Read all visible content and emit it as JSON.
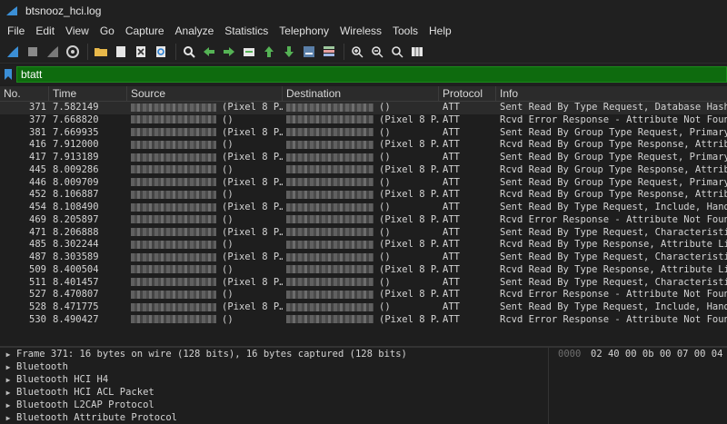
{
  "window": {
    "title": "btsnooz_hci.log"
  },
  "menu": [
    "File",
    "Edit",
    "View",
    "Go",
    "Capture",
    "Analyze",
    "Statistics",
    "Telephony",
    "Wireless",
    "Tools",
    "Help"
  ],
  "filter": {
    "value": "btatt"
  },
  "columns": {
    "no": "No.",
    "time": "Time",
    "source": "Source",
    "destination": "Destination",
    "protocol": "Protocol",
    "info": "Info"
  },
  "packets": [
    {
      "no": "371",
      "time": "7.582149",
      "src": "(Pixel 8 P…",
      "dst": "()",
      "proto": "ATT",
      "info": "Sent Read By Type Request, Database Hash,",
      "selected": true
    },
    {
      "no": "377",
      "time": "7.668820",
      "src": "()",
      "dst": "(Pixel 8 P…",
      "proto": "ATT",
      "info": "Rcvd Error Response - Attribute Not Found"
    },
    {
      "no": "381",
      "time": "7.669935",
      "src": "(Pixel 8 P…",
      "dst": "()",
      "proto": "ATT",
      "info": "Sent Read By Group Type Request, Primary"
    },
    {
      "no": "416",
      "time": "7.912000",
      "src": "()",
      "dst": "(Pixel 8 P…",
      "proto": "ATT",
      "info": "Rcvd Read By Group Type Response, Attribu"
    },
    {
      "no": "417",
      "time": "7.913189",
      "src": "(Pixel 8 P…",
      "dst": "()",
      "proto": "ATT",
      "info": "Sent Read By Group Type Request, Primary"
    },
    {
      "no": "445",
      "time": "8.009286",
      "src": "()",
      "dst": "(Pixel 8 P…",
      "proto": "ATT",
      "info": "Rcvd Read By Group Type Response, Attribu"
    },
    {
      "no": "446",
      "time": "8.009709",
      "src": "(Pixel 8 P…",
      "dst": "()",
      "proto": "ATT",
      "info": "Sent Read By Group Type Request, Primary"
    },
    {
      "no": "452",
      "time": "8.106887",
      "src": "()",
      "dst": "(Pixel 8 P…",
      "proto": "ATT",
      "info": "Rcvd Read By Group Type Response, Attribu"
    },
    {
      "no": "454",
      "time": "8.108490",
      "src": "(Pixel 8 P…",
      "dst": "()",
      "proto": "ATT",
      "info": "Sent Read By Type Request, Include, Handl"
    },
    {
      "no": "469",
      "time": "8.205897",
      "src": "()",
      "dst": "(Pixel 8 P…",
      "proto": "ATT",
      "info": "Rcvd Error Response - Attribute Not Found"
    },
    {
      "no": "471",
      "time": "8.206888",
      "src": "(Pixel 8 P…",
      "dst": "()",
      "proto": "ATT",
      "info": "Sent Read By Type Request, Characteristic"
    },
    {
      "no": "485",
      "time": "8.302244",
      "src": "()",
      "dst": "(Pixel 8 P…",
      "proto": "ATT",
      "info": "Rcvd Read By Type Response, Attribute Lis"
    },
    {
      "no": "487",
      "time": "8.303589",
      "src": "(Pixel 8 P…",
      "dst": "()",
      "proto": "ATT",
      "info": "Sent Read By Type Request, Characteristic"
    },
    {
      "no": "509",
      "time": "8.400504",
      "src": "()",
      "dst": "(Pixel 8 P…",
      "proto": "ATT",
      "info": "Rcvd Read By Type Response, Attribute Lis"
    },
    {
      "no": "511",
      "time": "8.401457",
      "src": "(Pixel 8 P…",
      "dst": "()",
      "proto": "ATT",
      "info": "Sent Read By Type Request, Characteristic"
    },
    {
      "no": "527",
      "time": "8.470807",
      "src": "()",
      "dst": "(Pixel 8 P…",
      "proto": "ATT",
      "info": "Rcvd Error Response - Attribute Not Found"
    },
    {
      "no": "528",
      "time": "8.471775",
      "src": "(Pixel 8 P…",
      "dst": "()",
      "proto": "ATT",
      "info": "Sent Read By Type Request, Include, Handl"
    },
    {
      "no": "530",
      "time": "8.490427",
      "src": "()",
      "dst": "(Pixel 8 P…",
      "proto": "ATT",
      "info": "Rcvd Error Response - Attribute Not Found"
    }
  ],
  "details": [
    "Frame 371: 16 bytes on wire (128 bits), 16 bytes captured (128 bits)",
    "Bluetooth",
    "Bluetooth HCI H4",
    "Bluetooth HCI ACL Packet",
    "Bluetooth L2CAP Protocol",
    "Bluetooth Attribute Protocol"
  ],
  "hex": {
    "offset": "0000",
    "bytes": "02 40 00 0b 00 07 00 04"
  },
  "colors": {
    "filter_valid": "#0e6b0e",
    "background": "#1e1e1e",
    "chrome": "#202020"
  }
}
